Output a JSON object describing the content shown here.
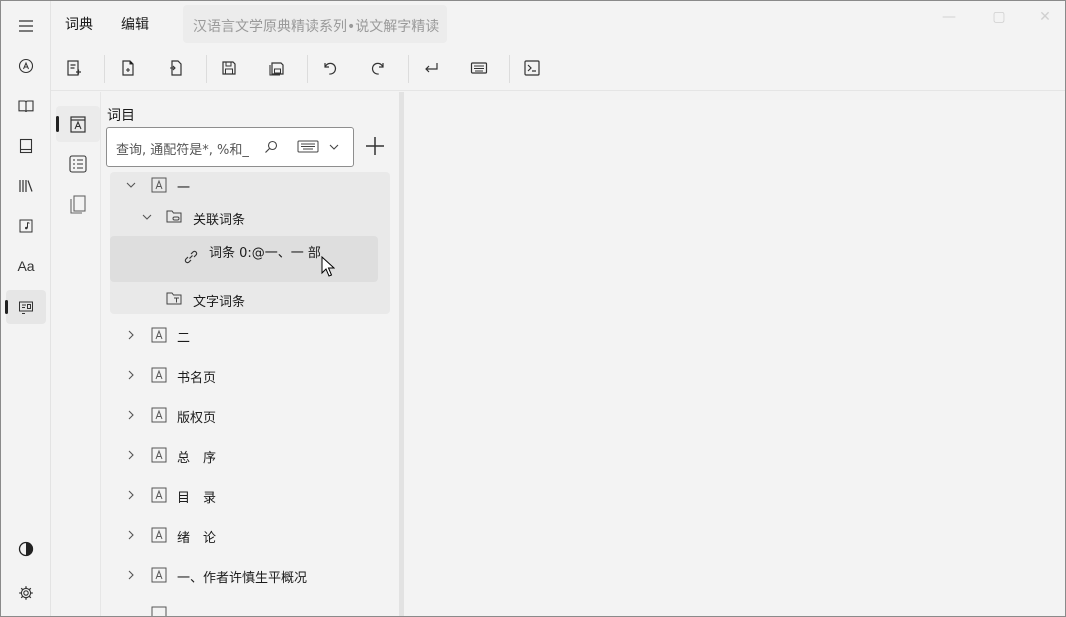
{
  "menubar": {
    "menu1": "词典",
    "menu2": "编辑",
    "title": "汉语言文学原典精读系列•说文解字精读"
  },
  "rail": {
    "items": [
      "menu-icon",
      "search-letter-icon",
      "book-open-icon",
      "book-icon",
      "library-icon",
      "music-note-icon",
      "font-icon",
      "dictionary-icon"
    ],
    "font_label": "Aa"
  },
  "toolbar": {
    "items": [
      "new-entry-icon",
      "new-file-icon",
      "open-file-icon",
      "save-icon",
      "save-all-icon",
      "undo-icon",
      "redo-icon",
      "enter-icon",
      "keyboard-panel-icon",
      "terminal-icon"
    ]
  },
  "panel": {
    "title": "词目",
    "search_placeholder": "查询, 通配符是*, %和_"
  },
  "tree": {
    "items": [
      {
        "label": "一"
      },
      {
        "label": "关联词条"
      },
      {
        "label": "词条 0:@一、一   部"
      },
      {
        "label": "文字词条"
      },
      {
        "label": "二"
      },
      {
        "label": "书名页"
      },
      {
        "label": "版权页"
      },
      {
        "label": "总　序"
      },
      {
        "label": "目　录"
      },
      {
        "label": "绪　论"
      },
      {
        "label": "一、作者许慎生平概况"
      }
    ]
  }
}
